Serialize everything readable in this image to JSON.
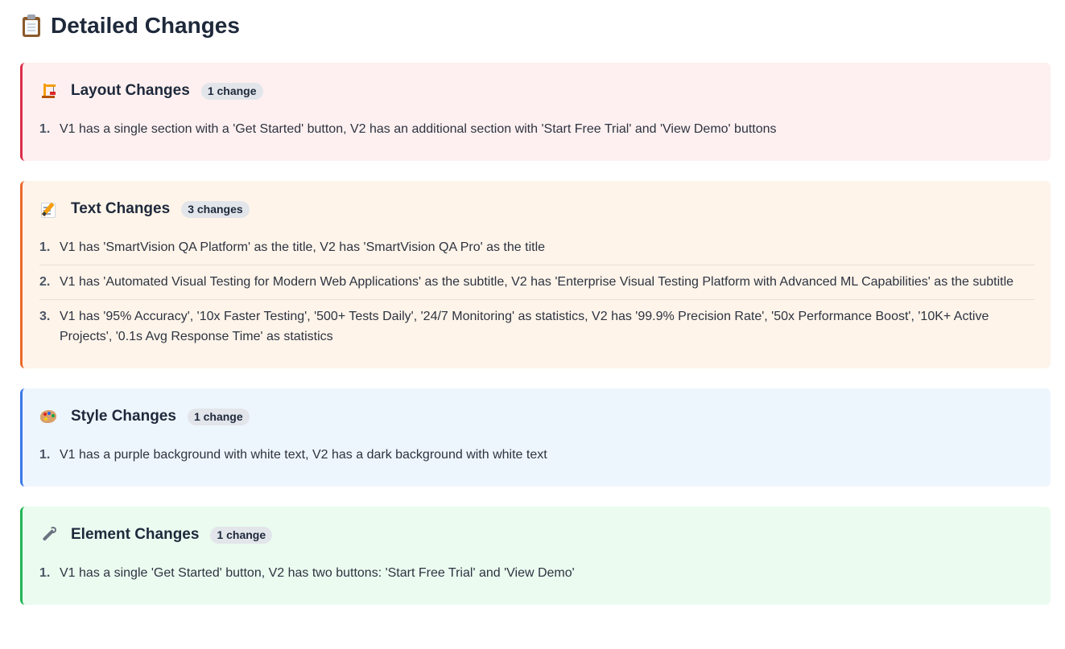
{
  "page": {
    "title": "Detailed Changes",
    "title_icon": "clipboard-icon"
  },
  "sections": [
    {
      "key": "layout",
      "icon": "construction-crane-icon",
      "title": "Layout Changes",
      "badge": "1 change",
      "accent": "#dc2e48",
      "items": [
        {
          "num": "1.",
          "text": "V1 has a single section with a 'Get Started' button, V2 has an additional section with 'Start Free Trial' and 'View Demo' buttons"
        }
      ]
    },
    {
      "key": "text",
      "icon": "memo-icon",
      "title": "Text Changes",
      "badge": "3 changes",
      "accent": "#ea6a2a",
      "items": [
        {
          "num": "1.",
          "text": "V1 has 'SmartVision QA Platform' as the title, V2 has 'SmartVision QA Pro' as the title"
        },
        {
          "num": "2.",
          "text": "V1 has 'Automated Visual Testing for Modern Web Applications' as the subtitle, V2 has 'Enterprise Visual Testing Platform with Advanced ML Capabilities' as the subtitle"
        },
        {
          "num": "3.",
          "text": "V1 has '95% Accuracy', '10x Faster Testing', '500+ Tests Daily', '24/7 Monitoring' as statistics, V2 has '99.9% Precision Rate', '50x Performance Boost', '10K+ Active Projects', '0.1s Avg Response Time' as statistics"
        }
      ]
    },
    {
      "key": "style",
      "icon": "palette-icon",
      "title": "Style Changes",
      "badge": "1 change",
      "accent": "#3b78e7",
      "items": [
        {
          "num": "1.",
          "text": "V1 has a purple background with white text, V2 has a dark background with white text"
        }
      ]
    },
    {
      "key": "element",
      "icon": "wrench-icon",
      "title": "Element Changes",
      "badge": "1 change",
      "accent": "#22b655",
      "items": [
        {
          "num": "1.",
          "text": "V1 has a single 'Get Started' button, V2 has two buttons: 'Start Free Trial' and 'View Demo'"
        }
      ]
    }
  ]
}
